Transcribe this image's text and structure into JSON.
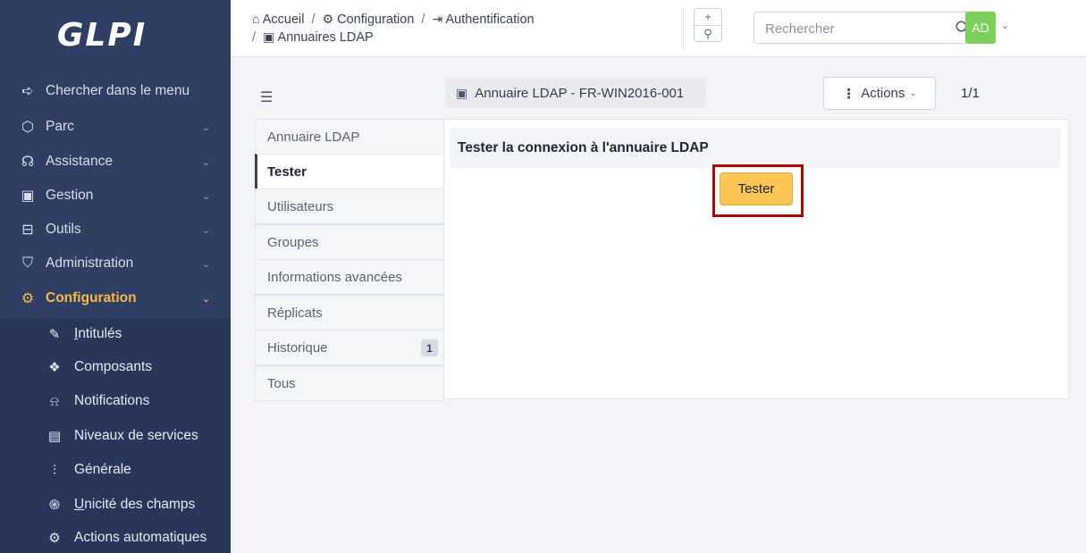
{
  "app": {
    "logo": "GLPI"
  },
  "sidebar": {
    "items": [
      {
        "label": "Chercher dans le menu",
        "icon": "arrow-right-icon",
        "glyph": "➪"
      },
      {
        "label": "Parc",
        "icon": "box-icon",
        "glyph": "⬡"
      },
      {
        "label": "Assistance",
        "icon": "headset-icon",
        "glyph": "☊"
      },
      {
        "label": "Gestion",
        "icon": "wallet-icon",
        "glyph": "▣"
      },
      {
        "label": "Outils",
        "icon": "briefcase-icon",
        "glyph": "⊟"
      },
      {
        "label": "Administration",
        "icon": "shield-icon",
        "glyph": "⛉"
      },
      {
        "label": "Configuration",
        "icon": "settings-icon",
        "glyph": "⚙"
      }
    ],
    "subitems": [
      {
        "label_pre": "",
        "label_u": "I",
        "label_post": "ntitulés",
        "icon": "edit-icon",
        "glyph": "✎"
      },
      {
        "label_pre": "Composants",
        "label_u": "",
        "label_post": "",
        "icon": "components-icon",
        "glyph": "❖"
      },
      {
        "label_pre": "Notifications",
        "label_u": "",
        "label_post": "",
        "icon": "bell-icon",
        "glyph": "♫"
      },
      {
        "label_pre": "Niveaux de services",
        "label_u": "",
        "label_post": "",
        "icon": "clipboard-icon",
        "glyph": "▤"
      },
      {
        "label_pre": "Générale",
        "label_u": "",
        "label_post": "",
        "icon": "adjustments-icon",
        "glyph": "⫶"
      },
      {
        "label_pre": "",
        "label_u": "U",
        "label_post": "nicité des champs",
        "icon": "fingerprint-icon",
        "glyph": "֍"
      },
      {
        "label_pre": "Actions automatiques",
        "label_u": "",
        "label_post": "",
        "icon": "automation-icon",
        "glyph": "⚙"
      }
    ]
  },
  "breadcrumb": {
    "home": "Accueil",
    "config": "Configuration",
    "auth": "Authentification",
    "ldap": "Annuaires LDAP",
    "separator": "/"
  },
  "header": {
    "plus": "+",
    "search_glyph": "⚲",
    "search_placeholder": "Rechercher",
    "avatar": "AD"
  },
  "record": {
    "title": "Annuaire LDAP - FR-WIN2016-001",
    "actions_label": "Actions",
    "pager": "1/1"
  },
  "tabs": [
    {
      "label": "Annuaire LDAP"
    },
    {
      "label": "Tester",
      "active": true
    },
    {
      "label": "Utilisateurs"
    },
    {
      "label": "Groupes"
    },
    {
      "label": "Informations avancées"
    },
    {
      "label": "Réplicats"
    },
    {
      "label": "Historique",
      "badge": "1"
    },
    {
      "label": "Tous"
    }
  ],
  "panel": {
    "heading": "Tester la connexion à l'annuaire LDAP",
    "button": "Tester",
    "highlight_color": "#b00606"
  },
  "colors": {
    "sidebar_bg": "#2f3f64",
    "active_accent": "#f5b944",
    "button_bg": "#fbc654",
    "avatar_bg": "#7bd05c"
  }
}
